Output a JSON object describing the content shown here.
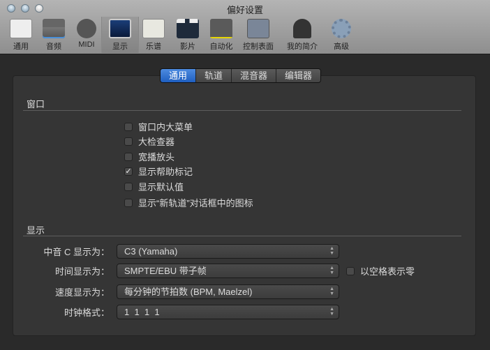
{
  "window": {
    "title": "偏好设置"
  },
  "toolbar": [
    {
      "label": "通用",
      "icon": "switch-icon"
    },
    {
      "label": "音频",
      "icon": "waveform-icon"
    },
    {
      "label": "MIDI",
      "icon": "midi-port-icon"
    },
    {
      "label": "显示",
      "icon": "monitor-icon",
      "selected": true
    },
    {
      "label": "乐谱",
      "icon": "music-note-icon"
    },
    {
      "label": "影片",
      "icon": "clapperboard-icon"
    },
    {
      "label": "自动化",
      "icon": "automation-icon"
    },
    {
      "label": "控制表面",
      "icon": "faders-icon"
    },
    {
      "label": "我的简介",
      "icon": "user-icon"
    },
    {
      "label": "高级",
      "icon": "gear-icon"
    }
  ],
  "tabs": [
    {
      "label": "通用",
      "active": true
    },
    {
      "label": "轨道"
    },
    {
      "label": "混音器"
    },
    {
      "label": "编辑器"
    }
  ],
  "window_section": {
    "title": "窗口",
    "options": [
      {
        "label": "窗口内大菜单",
        "checked": false
      },
      {
        "label": "大检查器",
        "checked": false
      },
      {
        "label": "宽播放头",
        "checked": false
      },
      {
        "label": "显示帮助标记",
        "checked": true
      },
      {
        "label": "显示默认值",
        "checked": false
      },
      {
        "label": "显示“新轨道”对话框中的图标",
        "checked": false
      }
    ]
  },
  "display_section": {
    "title": "显示",
    "fields": [
      {
        "label": "中音 C 显示为：",
        "value": "C3 (Yamaha)"
      },
      {
        "label": "时间显示为：",
        "value": "SMPTE/EBU 带子帧"
      },
      {
        "label": "速度显示为：",
        "value": "每分钟的节拍数 (BPM, Maelzel)"
      },
      {
        "label": "时钟格式：",
        "value": "1  1  1  1"
      }
    ],
    "zero_as_space": {
      "label": "以空格表示零",
      "checked": false
    }
  }
}
